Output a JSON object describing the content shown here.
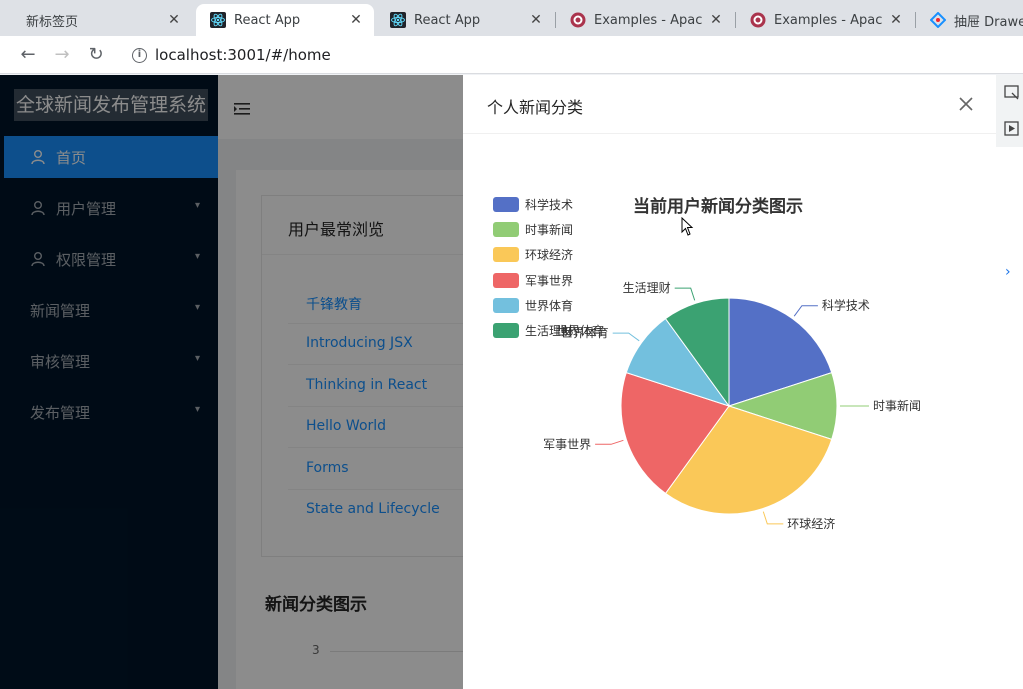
{
  "browser": {
    "tabs": [
      {
        "title": "新标签页",
        "icon": "blank-tab-icon"
      },
      {
        "title": "React App",
        "icon": "react-logo-icon"
      },
      {
        "title": "React App",
        "icon": "react-logo-icon"
      },
      {
        "title": "Examples - Apache",
        "icon": "echarts-logo-icon"
      },
      {
        "title": "Examples - Apache",
        "icon": "echarts-logo-icon"
      },
      {
        "title": "抽屉 Drawer",
        "icon": "antd-logo-icon"
      }
    ],
    "url": "localhost:3001/#/home"
  },
  "app": {
    "title": "全球新闻发布管理系统",
    "menu": [
      {
        "label": "首页",
        "icon": "user-icon"
      },
      {
        "label": "用户管理",
        "icon": "user-icon"
      },
      {
        "label": "权限管理",
        "icon": "user-icon"
      },
      {
        "label": "新闻管理"
      },
      {
        "label": "审核管理"
      },
      {
        "label": "发布管理"
      }
    ]
  },
  "home": {
    "card_title": "用户最常浏览",
    "links": [
      "千锋教育",
      "Introducing JSX",
      "Thinking in React",
      "Hello World",
      "Forms",
      "State and Lifecycle"
    ],
    "section_title": "新闻分类图示",
    "axis_tick": "3"
  },
  "drawer": {
    "title": "个人新闻分类"
  },
  "chart_data": {
    "type": "pie",
    "title": "当前用户新闻分类图示",
    "legend_position": "top-left",
    "categories": [
      "科学技术",
      "时事新闻",
      "环球经济",
      "军事世界",
      "世界体育",
      "生活理财"
    ],
    "values": [
      2,
      1,
      3,
      2,
      1,
      1
    ],
    "colors": [
      "#5470c6",
      "#91cc75",
      "#fac858",
      "#ee6666",
      "#73c0de",
      "#3ba272"
    ],
    "legend_labels": [
      "科学技术",
      "时事新闻",
      "环球经济",
      "军事世界",
      "世界体育",
      "生活理财"
    ],
    "overlapped_label": "世界体育"
  }
}
